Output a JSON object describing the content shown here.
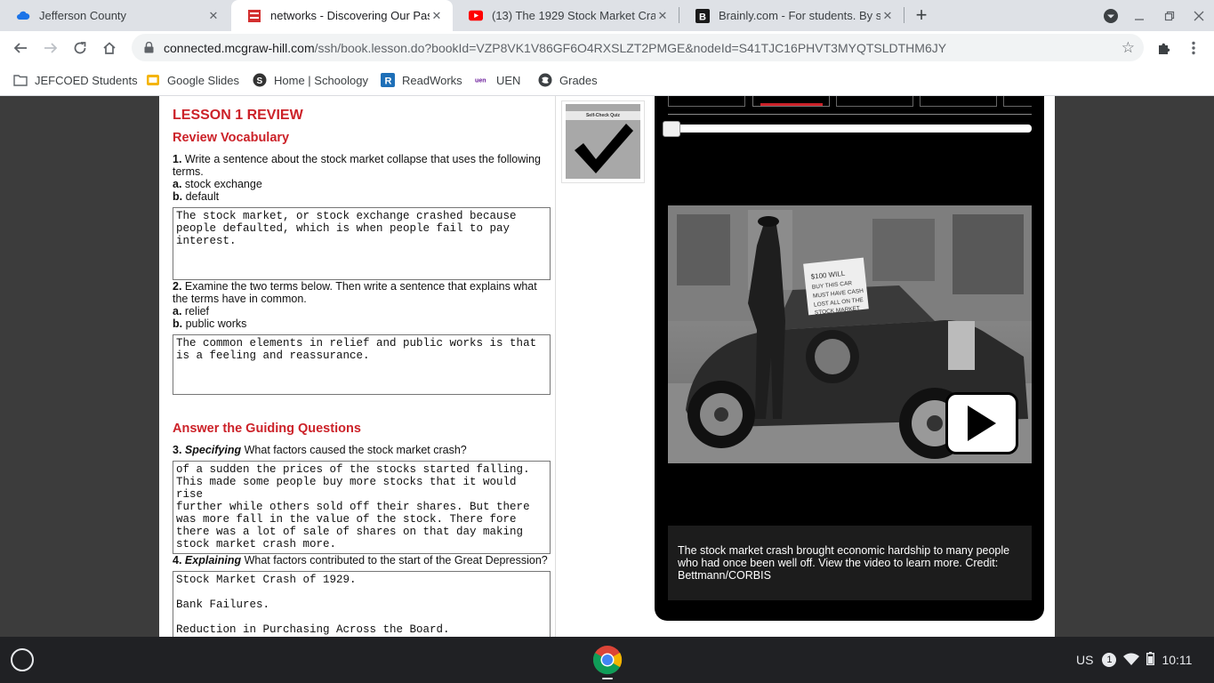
{
  "browser": {
    "tabs": [
      {
        "title": "Jefferson County",
        "icon": "cloud-icon",
        "active": false
      },
      {
        "title": "networks - Discovering Our Past",
        "icon": "mcgraw-hill-icon",
        "active": true
      },
      {
        "title": "(13) The 1929 Stock Market Cras",
        "icon": "youtube-icon",
        "active": false
      },
      {
        "title": "Brainly.com - For students. By st",
        "icon": "brainly-icon",
        "active": false
      }
    ],
    "url_host": "connected.mcgraw-hill.com",
    "url_path": "/ssh/book.lesson.do?bookId=VZP8VK1V86GF6O4RXSLZT2PMGE&nodeId=S41TJC16PHVT3MYQTSLDTHM6JY",
    "bookmarks": [
      {
        "label": "JEFCOED Students",
        "icon": "folder-icon"
      },
      {
        "label": "Google Slides",
        "icon": "google-slides-icon"
      },
      {
        "label": "Home | Schoology",
        "icon": "schoology-icon"
      },
      {
        "label": "ReadWorks",
        "icon": "readworks-icon"
      },
      {
        "label": "UEN",
        "icon": "uen-icon"
      },
      {
        "label": "Grades",
        "icon": "grades-icon"
      }
    ]
  },
  "lesson": {
    "title": "LESSON 1 REVIEW",
    "vocab_heading": "Review Vocabulary",
    "q1": {
      "num": "1.",
      "text": "Write a sentence about the stock market collapse that uses the following terms.",
      "a_label": "a.",
      "a_text": "stock exchange",
      "b_label": "b.",
      "b_text": "default",
      "answer": "The stock market, or stock exchange crashed because\npeople defaulted, which is when people fail to pay\ninterest."
    },
    "q2": {
      "num": "2.",
      "text": "Examine the two terms below. Then write a sentence that explains what the terms have in common.",
      "a_label": "a.",
      "a_text": "relief",
      "b_label": "b.",
      "b_text": "public works",
      "answer": "The common elements in relief and public works is that\nis a feeling and reassurance."
    },
    "guiding_heading": "Answer the Guiding Questions",
    "q3": {
      "num": "3.",
      "skill": "Specifying",
      "text": "What factors caused the stock market crash?",
      "answer": "of a sudden the prices of the stocks started falling.\nThis made some people buy more stocks that it would rise\nfurther while others sold off their shares. But there\nwas more fall in the value of the stock. There fore\nthere was a lot of sale of shares on that day making\nstock market crash more."
    },
    "q4": {
      "num": "4.",
      "skill": "Explaining",
      "text": "What factors contributed to the start of the Great Depression?",
      "answer": "Stock Market Crash of 1929.\n\nBank Failures.\n\nReduction in Purchasing Across the Board."
    },
    "quiz_label": "Self-Check Quiz"
  },
  "media": {
    "photo_sign": "$100 WILL BUY THIS CAR MUST HAVE CASH LOST ALL ON THE STOCK MARKET",
    "caption": "The stock market crash brought economic hardship to many people who had once been well off. View the video to learn more. Credit: Bettmann/CORBIS",
    "slider_position": 0
  },
  "system": {
    "input_method": "US",
    "notification_count": "1",
    "time": "10:11"
  },
  "colors": {
    "accent_red": "#cc2229",
    "page_bg": "#3c3c3c"
  }
}
